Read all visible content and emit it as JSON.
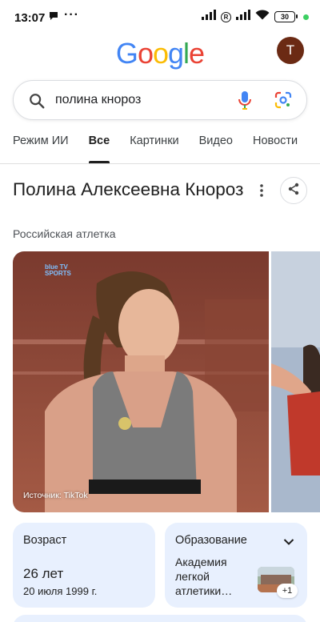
{
  "status_bar": {
    "time": "13:07",
    "dots": "···",
    "battery": "30"
  },
  "header": {
    "logo_letters": [
      {
        "char": "G",
        "color": "#4285F4"
      },
      {
        "char": "o",
        "color": "#EA4335"
      },
      {
        "char": "o",
        "color": "#FBBC05"
      },
      {
        "char": "g",
        "color": "#4285F4"
      },
      {
        "char": "l",
        "color": "#34A853"
      },
      {
        "char": "e",
        "color": "#EA4335"
      }
    ],
    "avatar_initial": "T"
  },
  "search": {
    "query": "полина кнороз"
  },
  "tabs": [
    {
      "label": "Режим ИИ",
      "active": false
    },
    {
      "label": "Все",
      "active": true
    },
    {
      "label": "Картинки",
      "active": false
    },
    {
      "label": "Видео",
      "active": false
    },
    {
      "label": "Новости",
      "active": false
    }
  ],
  "knowledge_panel": {
    "title": "Полина Алексеевна Кнороз",
    "subtitle": "Российская атлетка",
    "image_source": "Источник: TikTok",
    "image_logo_line1": "blue TV",
    "image_logo_line2": "SPORTS"
  },
  "cards": {
    "age": {
      "label": "Возраст",
      "value": "26 лет",
      "date": "20 июля 1999 г."
    },
    "education": {
      "label": "Образование",
      "value": "Академия легкой атлетики…",
      "extra_count": "+1"
    }
  },
  "colors": {
    "card_bg": "#e8f0fe",
    "avatar_bg": "#6b2a14",
    "accent": "#1a73e8"
  }
}
